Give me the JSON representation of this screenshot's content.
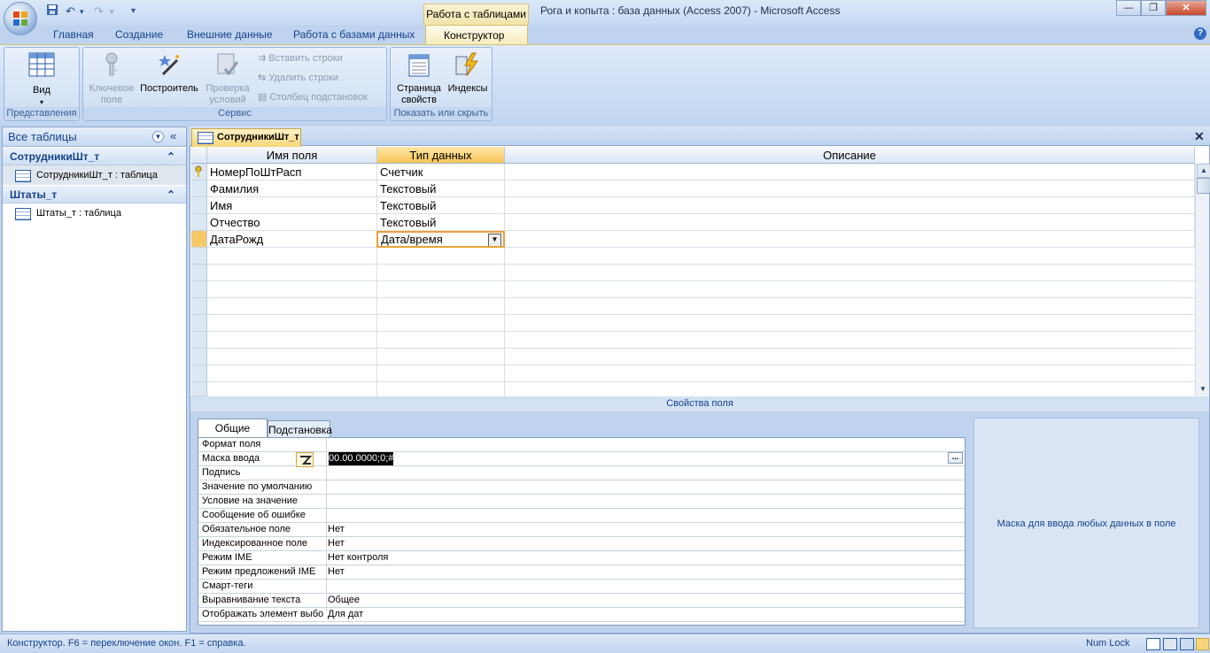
{
  "window": {
    "context_tab": "Работа с таблицами",
    "title": "Рога и копыта : база данных (Access 2007) - Microsoft Access",
    "min_symbol": "—",
    "max_symbol": "❐",
    "close_symbol": "✕"
  },
  "qat": {
    "save_icon": "save-icon",
    "undo": "↶",
    "redo": "↷",
    "more": "▾"
  },
  "ribbon": {
    "tabs": [
      "Главная",
      "Создание",
      "Внешние данные",
      "Работа с базами данных",
      "Конструктор"
    ],
    "groups": {
      "views": {
        "label": "Представления",
        "view_button": "Вид",
        "view_arrow": "▾"
      },
      "tools": {
        "label": "Сервис",
        "primary_key_1": "Ключевое",
        "primary_key_2": "поле",
        "builder": "Построитель",
        "test_1": "Проверка",
        "test_2": "условий",
        "insert_rows": "Вставить строки",
        "delete_rows": "Удалить строки",
        "lookup_column": "Столбец  подстановок"
      },
      "show_hide": {
        "label": "Показать или скрыть",
        "sheet_1": "Страница",
        "sheet_2": "свойств",
        "indexes": "Индексы"
      }
    }
  },
  "nav": {
    "header": "Все таблицы",
    "groups": [
      {
        "name": "СотрудникиШт_т",
        "items": [
          "СотрудникиШт_т : таблица"
        ]
      },
      {
        "name": "Штаты_т",
        "items": [
          "Штаты_т : таблица"
        ]
      }
    ]
  },
  "document": {
    "tab_title": "СотрудникиШт_т",
    "columns": [
      "Имя поля",
      "Тип данных",
      "Описание"
    ],
    "rows": [
      {
        "field": "НомерПоШтРасп",
        "type": "Счетчик",
        "desc": ""
      },
      {
        "field": "Фамилия",
        "type": "Текстовый",
        "desc": ""
      },
      {
        "field": "Имя",
        "type": "Текстовый",
        "desc": ""
      },
      {
        "field": "Отчество",
        "type": "Текстовый",
        "desc": ""
      },
      {
        "field": "ДатаРожд",
        "type": "Дата/время",
        "desc": ""
      }
    ]
  },
  "props": {
    "strip_title": "Свойства поля",
    "tabs": [
      "Общие",
      "Подстановка"
    ],
    "rows": [
      {
        "label": "Формат поля",
        "value": ""
      },
      {
        "label": "Маска ввода",
        "value": "00.00.0000;0;#"
      },
      {
        "label": "Подпись",
        "value": ""
      },
      {
        "label": "Значение по умолчанию",
        "value": ""
      },
      {
        "label": "Условие на значение",
        "value": ""
      },
      {
        "label": "Сообщение об ошибке",
        "value": ""
      },
      {
        "label": "Обязательное поле",
        "value": "Нет"
      },
      {
        "label": "Индексированное поле",
        "value": "Нет"
      },
      {
        "label": "Режим IME",
        "value": "Нет контроля"
      },
      {
        "label": "Режим предложений IME",
        "value": "Нет"
      },
      {
        "label": "Смарт-теги",
        "value": ""
      },
      {
        "label": "Выравнивание текста",
        "value": "Общее"
      },
      {
        "label": "Отображать элемент выбора даты",
        "value": "Для дат"
      }
    ],
    "builder_button": "...",
    "help_text": "Маска для ввода любых данных в поле"
  },
  "status": {
    "left": "Конструктор.  F6 = переключение окон.  F1 = справка.",
    "numlock": "Num Lock"
  },
  "colors": {
    "accent": "#f7c456",
    "ribbon_blue": "#bfd3ee",
    "text_blue": "#15428b"
  }
}
